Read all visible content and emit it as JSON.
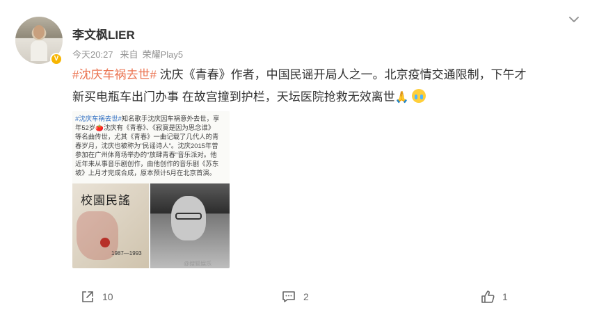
{
  "post": {
    "author": {
      "name": "李文枫LIER",
      "verified_badge": "V"
    },
    "meta": {
      "time": "今天20:27",
      "source_prefix": "来自",
      "source": "荣耀Play5"
    },
    "text": {
      "topic": "#沈庆车祸去世#",
      "line1_rest": " 沈庆《青春》作者，中国民谣开局人之一。北京疫情交通限制，下午才",
      "line2": "新买电瓶车出门办事 在故宫撞到护栏，天坛医院抢救无效离世",
      "emoji": [
        "pray-icon",
        "crying-face-icon"
      ]
    },
    "image": {
      "news_topic": "#沈庆车祸去世#",
      "news_lines": [
        "知名歌手沈庆因车祸意外去世，享",
        "年52岁🍅沈庆有《青春》、《寂寞是因为思念谁》",
        "等名曲传世，尤其《青春》一曲记载了几代人的青",
        "春岁月，沈庆也被称为\"民谣诗人\"。沈庆2015年曾",
        "参加在广州体育场举办的\"放肆青春\"音乐派对。他",
        "近年来从事音乐剧创作，由他创作的音乐剧《苏东",
        "坡》上月才完成合成，原本预计5月在北京首演。"
      ],
      "cover_title": "校園民謠",
      "cover_years": "1987—1993",
      "watermark": "@搜狐娱乐"
    },
    "actions": {
      "repost_count": "10",
      "comment_count": "2",
      "like_count": "1"
    }
  },
  "colors": {
    "topic": "#eb7350",
    "meta": "#939393",
    "badge": "#f7b500"
  }
}
